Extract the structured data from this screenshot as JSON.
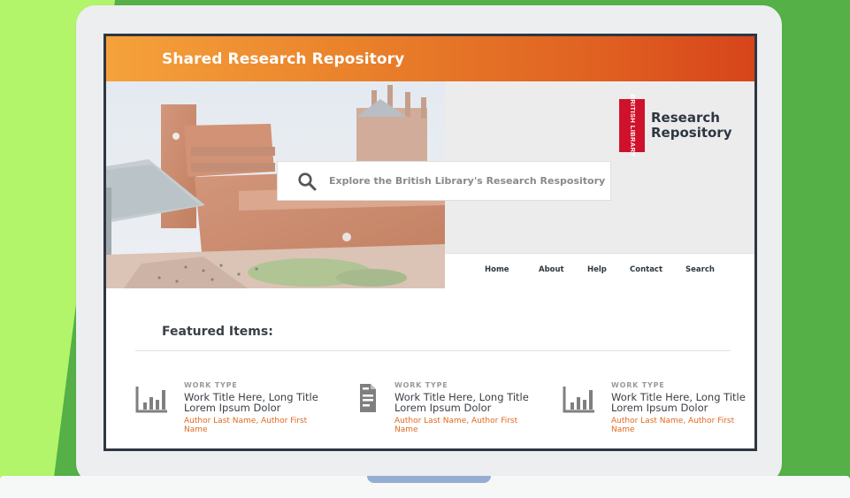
{
  "site": {
    "title": "Shared Research Repository"
  },
  "brand": {
    "logo_text": "BRITISH LIBRARY",
    "name_line1": "Research",
    "name_line2": "Repository"
  },
  "search": {
    "placeholder": "Explore the British Library's Research Respository"
  },
  "nav": {
    "items": [
      "Home",
      "About",
      "Help",
      "Contact",
      "Search"
    ]
  },
  "featured": {
    "heading": "Featured Items:",
    "items": [
      {
        "icon": "bar-chart-icon",
        "type": "WORK TYPE",
        "title": "Work Title Here, Long Title Lorem Ipsum Dolor",
        "author": "Author Last Name, Author First Name"
      },
      {
        "icon": "document-icon",
        "type": "WORK TYPE",
        "title": "Work Title Here, Long Title Lorem Ipsum Dolor",
        "author": "Author Last Name, Author First Name"
      },
      {
        "icon": "bar-chart-icon",
        "type": "WORK TYPE",
        "title": "Work Title Here, Long Title Lorem Ipsum Dolor",
        "author": "Author Last Name, Author First Name"
      }
    ]
  },
  "colors": {
    "background_green": "#54b047",
    "background_lime": "#b2f46a",
    "header_orange_start": "#f5a23b",
    "header_orange_end": "#d7441b",
    "logo_red": "#d0112b",
    "author_orange": "#e06a1e"
  }
}
